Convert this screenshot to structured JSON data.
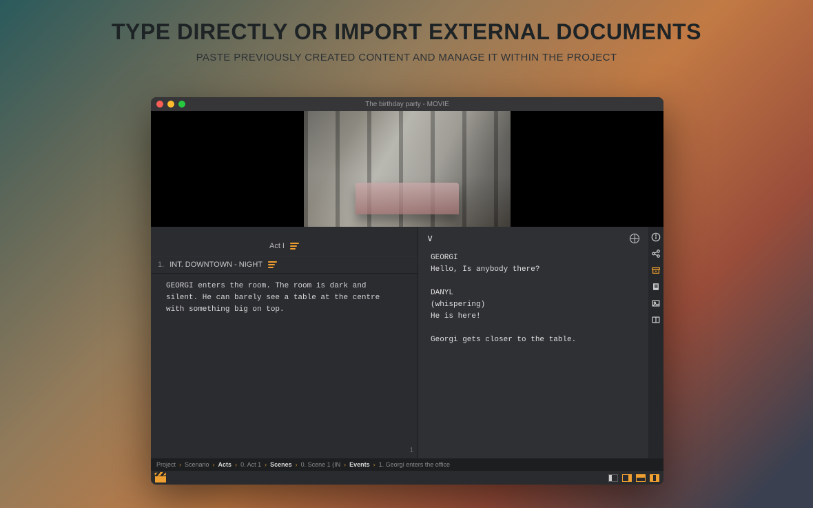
{
  "marketing": {
    "title": "TYPE DIRECTLY OR IMPORT EXTERNAL DOCUMENTS",
    "subtitle": "PASTE PREVIOUSLY CREATED CONTENT AND MANAGE IT WITHIN THE PROJECT"
  },
  "window": {
    "title": "The birthday party - MOVIE"
  },
  "left": {
    "act_label": "Act I",
    "scene_num": "1.",
    "scene_heading": "INT.  DOWNTOWN - NIGHT",
    "scene_body": "GEORGI enters the room. The room is dark and silent. He can barely see a table at the centre with something big on top.",
    "page_num": "1"
  },
  "right": {
    "script": "GEORGI\nHello, Is anybody there?\n\nDANYL\n(whispering)\nHe is here!\n\nGeorgi gets closer to the table."
  },
  "breadcrumb": {
    "items": [
      "Project",
      "Scenario",
      "Acts",
      "0. Act 1",
      "Scenes",
      "0. Scene 1 (IN",
      "Events",
      "1. Georgi enters the office"
    ],
    "bold": [
      2,
      4,
      6
    ]
  },
  "icons": {
    "info": "info-icon",
    "share": "share-icon",
    "archive": "archive-icon",
    "doc": "document-icon",
    "image": "image-icon",
    "split": "split-icon"
  }
}
